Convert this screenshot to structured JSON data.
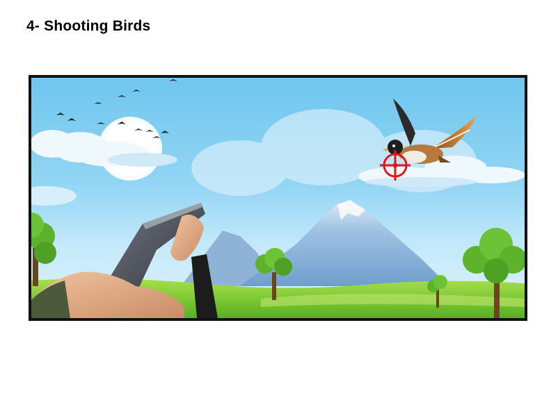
{
  "page": {
    "heading": "4- Shooting Birds"
  },
  "game": {
    "scene": "duck-hunt-style shooting gallery",
    "icons": [
      "sun",
      "flock-of-birds",
      "flying-bird-target",
      "crosshair",
      "mountain",
      "tree",
      "shotgun",
      "hand"
    ],
    "colors": {
      "sky_top": "#6fc6ee",
      "sky_bottom": "#dff3fb",
      "grass": "#7ccb2e",
      "crosshair": "#e0161b",
      "mountain": "#8fb6d9",
      "frame": "#111111"
    }
  }
}
